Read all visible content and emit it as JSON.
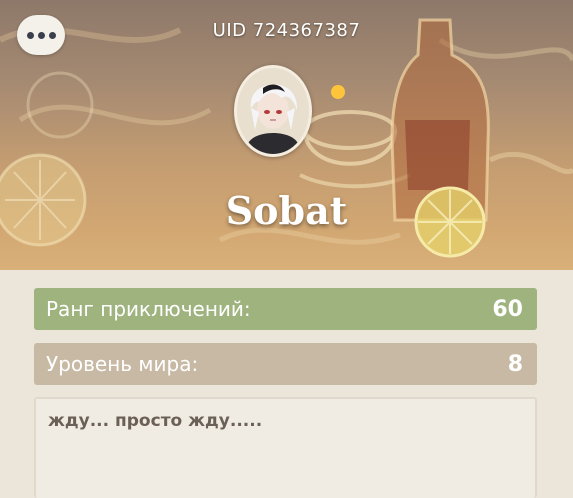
{
  "header": {
    "uid_text": "UID 724367387",
    "menu_icon": "more-dots-icon"
  },
  "profile": {
    "avatar_icon": "character-avatar",
    "nickname": "Sobat"
  },
  "stats": {
    "adventure_rank_label": "Ранг приключений:",
    "adventure_rank_value": "60",
    "world_level_label": "Уровень мира:",
    "world_level_value": "8"
  },
  "signature": {
    "text": "жду... просто жду....."
  },
  "colors": {
    "rank_row": "#9fb37f",
    "world_row": "#c8b9a5",
    "card_bg": "#ece5da"
  }
}
